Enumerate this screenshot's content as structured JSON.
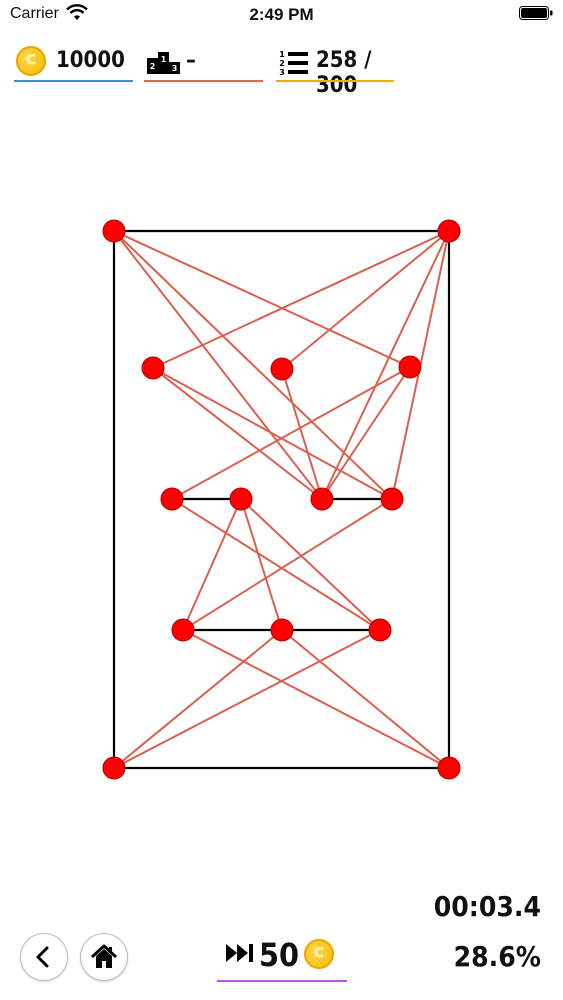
{
  "status_bar": {
    "carrier": "Carrier",
    "time": "2:49 PM",
    "icons": [
      "wifi-icon",
      "battery-icon"
    ]
  },
  "hud": {
    "coins": "10000",
    "rank": "–",
    "level": "258 / 300",
    "underline_colors": {
      "coins": "#3b8fd6",
      "rank": "#e06a5a",
      "level": "#e8b400"
    },
    "icons": [
      "coin-icon",
      "podium-icon",
      "level-list-icon"
    ]
  },
  "board": {
    "node_color": "#ff0000",
    "line_color": "#d9604f",
    "border_color": "#000000",
    "nodes": [
      {
        "id": "a"
      },
      {
        "id": "b"
      },
      {
        "id": "c"
      },
      {
        "id": "d"
      },
      {
        "id": "e"
      },
      {
        "id": "f"
      },
      {
        "id": "g"
      },
      {
        "id": "h"
      },
      {
        "id": "i"
      },
      {
        "id": "j"
      },
      {
        "id": "k"
      },
      {
        "id": "l"
      },
      {
        "id": "m"
      },
      {
        "id": "n"
      }
    ],
    "black_edges": [
      [
        "a",
        "b"
      ],
      [
        "b",
        "n"
      ],
      [
        "n",
        "m"
      ],
      [
        "m",
        "a"
      ],
      [
        "f",
        "g"
      ],
      [
        "h",
        "i"
      ],
      [
        "j",
        "k"
      ],
      [
        "k",
        "l"
      ]
    ],
    "red_edges": [
      [
        "a",
        "e"
      ],
      [
        "a",
        "h"
      ],
      [
        "a",
        "i"
      ],
      [
        "b",
        "c"
      ],
      [
        "b",
        "d"
      ],
      [
        "b",
        "h"
      ],
      [
        "b",
        "i"
      ],
      [
        "c",
        "h"
      ],
      [
        "c",
        "i"
      ],
      [
        "d",
        "h"
      ],
      [
        "e",
        "f"
      ],
      [
        "e",
        "h"
      ],
      [
        "g",
        "j"
      ],
      [
        "g",
        "k"
      ],
      [
        "g",
        "l"
      ],
      [
        "f",
        "l"
      ],
      [
        "j",
        "i"
      ],
      [
        "j",
        "n"
      ],
      [
        "k",
        "m"
      ],
      [
        "k",
        "n"
      ],
      [
        "l",
        "m"
      ]
    ]
  },
  "bottom": {
    "skip_cost": "50",
    "timer": "00:03.4",
    "progress": "28.6%",
    "icons": [
      "back-chevron-icon",
      "home-icon",
      "skip-forward-icon",
      "coin-icon"
    ]
  }
}
